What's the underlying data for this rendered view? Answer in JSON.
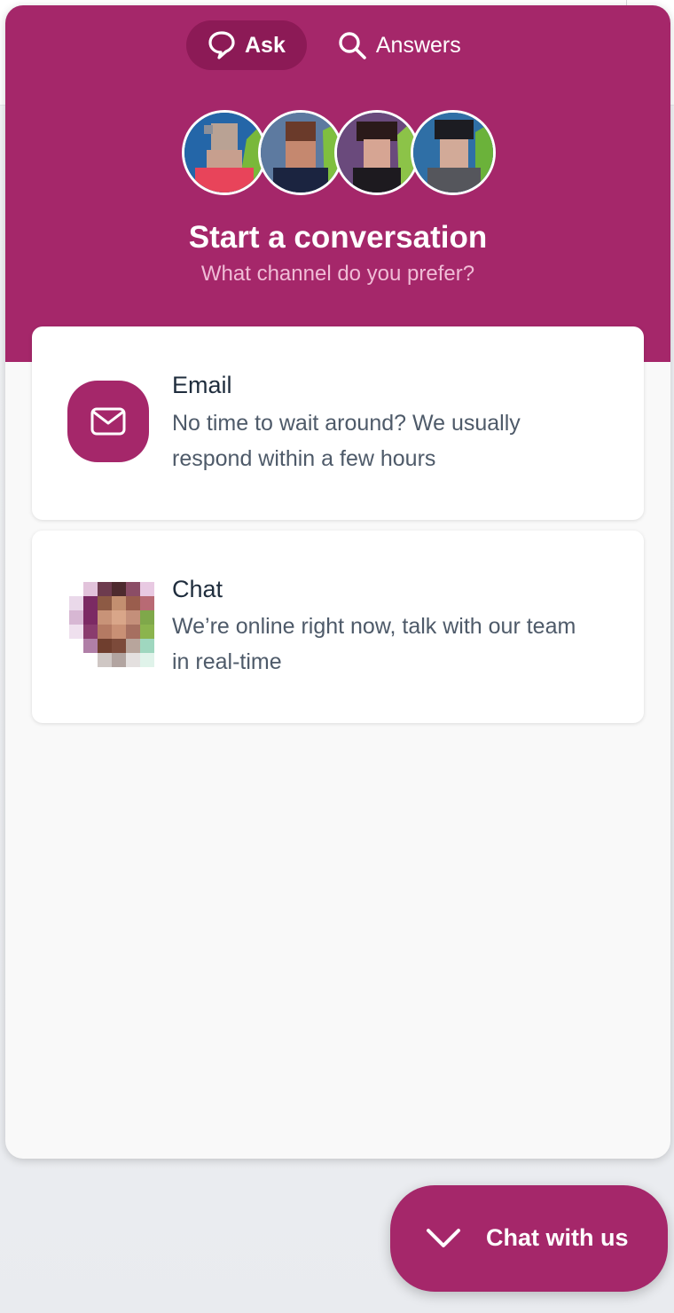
{
  "tabs": [
    {
      "label": "Ask",
      "icon": "chat-bubble-icon",
      "active": true
    },
    {
      "label": "Answers",
      "icon": "search-icon",
      "active": false
    }
  ],
  "hero": {
    "title": "Start a conversation",
    "subtitle": "What channel do you prefer?"
  },
  "options": {
    "email": {
      "title": "Email",
      "description": "No time to wait around? We usually respond within a few hours",
      "icon": "envelope-icon"
    },
    "chat": {
      "title": "Chat",
      "description": "We’re online right now, talk with our team in real-time",
      "icon": "agent-avatar"
    }
  },
  "launcher": {
    "label": "Chat with us",
    "icon": "chevron-down-icon"
  },
  "colors": {
    "brand": "#a5276a",
    "brand_dark": "#8c1a56",
    "subtitle": "#f0bcd6"
  }
}
